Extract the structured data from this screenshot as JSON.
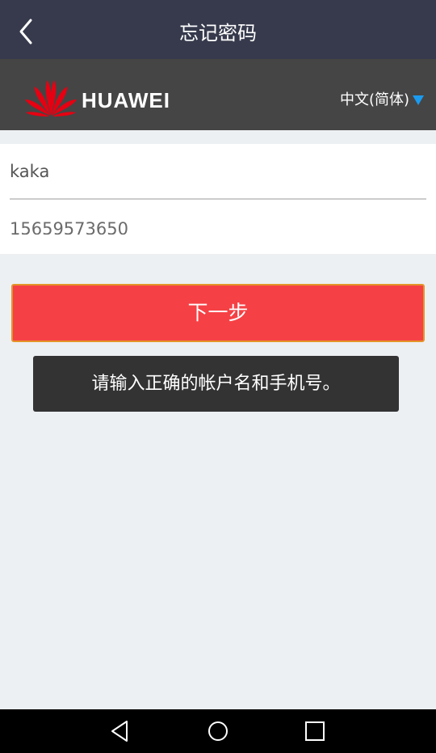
{
  "titlebar": {
    "title": "忘记密码",
    "back_icon": "chevron-left-icon"
  },
  "brand": {
    "name": "HUAWEI",
    "language": "中文(简体)",
    "language_arrow_color": "#1a9bf0",
    "logo_color": "#e60012"
  },
  "form": {
    "account_value": "kaka",
    "phone_value": "15659573650"
  },
  "next_button": {
    "label": "下一步",
    "color": "#f54145"
  },
  "toast": {
    "message": "请输入正确的帐户名和手机号。"
  },
  "navbar": {
    "back": "triangle-back-icon",
    "home": "circle-home-icon",
    "recents": "square-recents-icon"
  }
}
